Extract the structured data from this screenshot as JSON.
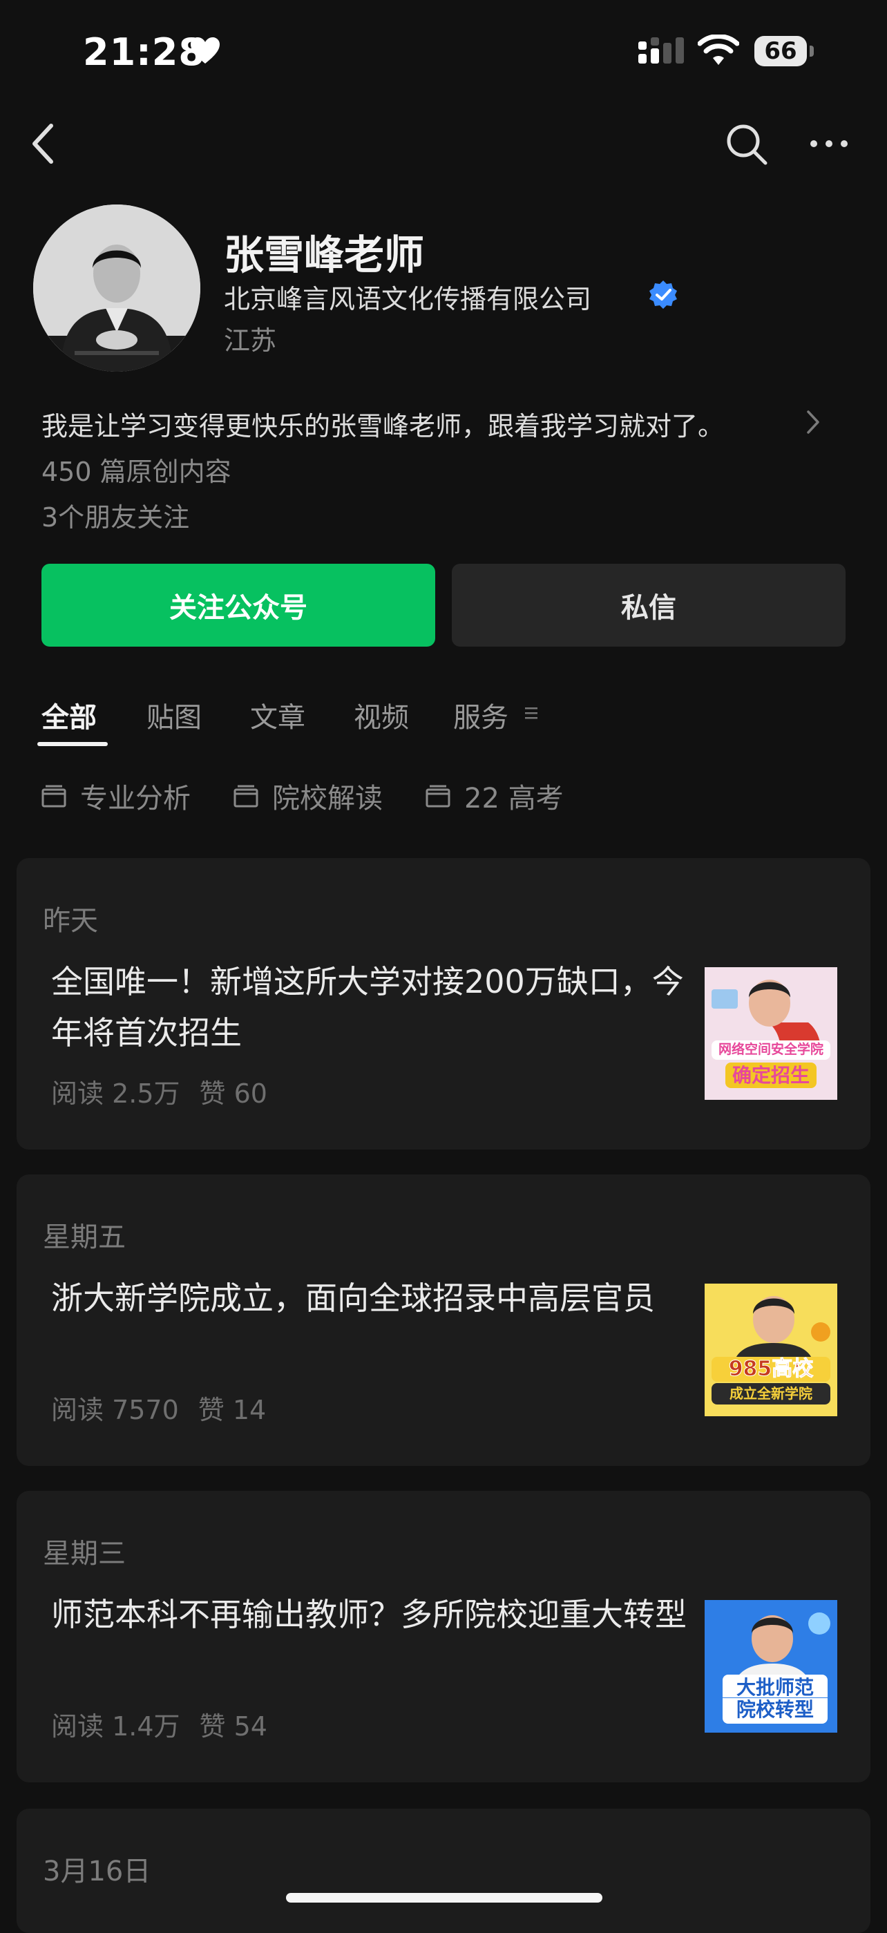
{
  "status_bar": {
    "time": "21:28",
    "battery": "66"
  },
  "profile": {
    "name": "张雪峰老师",
    "company": "北京峰言风语文化传播有限公司",
    "region": "江苏",
    "bio": "我是让学习变得更快乐的张雪峰老师，跟着我学习就对了。",
    "original_count": "450 篇原创内容",
    "friends_follow": "3个朋友关注"
  },
  "actions": {
    "follow": "关注公众号",
    "message": "私信"
  },
  "tabs": [
    {
      "label": "全部",
      "active": true
    },
    {
      "label": "贴图"
    },
    {
      "label": "文章"
    },
    {
      "label": "视频"
    },
    {
      "label": "服务"
    }
  ],
  "collections": [
    "专业分析",
    "院校解读",
    "22 高考"
  ],
  "articles": [
    {
      "date": "昨天",
      "title": "全国唯一！新增这所大学对接200万缺口，今年将首次招生",
      "reads": "阅读 2.5万",
      "likes": "赞 60",
      "thumb": {
        "line1": "网络空间安全学院",
        "line2": "确定招生",
        "bg": "#f4d9e8",
        "accent": "#e7489a"
      }
    },
    {
      "date": "星期五",
      "title": "浙大新学院成立，面向全球招录中高层官员",
      "reads": "阅读 7570",
      "likes": "赞 14",
      "thumb": {
        "line1": "985高校",
        "line2": "成立全新学院",
        "bg": "#f6d64a",
        "accent": "#c63b1d"
      }
    },
    {
      "date": "星期三",
      "title": "师范本科不再输出教师？多所院校迎重大转型",
      "reads": "阅读 1.4万",
      "likes": "赞 54",
      "thumb": {
        "line1": "大批师范",
        "line2": "院校转型",
        "bg": "#2e7ee6",
        "accent": "#1e5fc7"
      }
    }
  ],
  "next_date": "3月16日",
  "colors": {
    "accent_green": "#07c160",
    "verified_blue": "#3b8cff",
    "background": "#111111",
    "card": "#1c1c1c"
  }
}
